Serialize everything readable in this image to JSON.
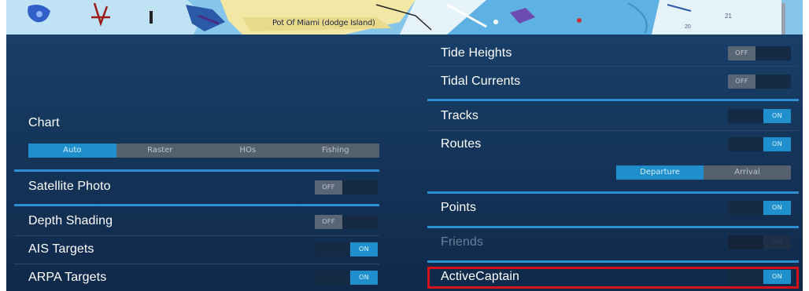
{
  "map": {
    "label": "Pot Of Miami (dodge Island)",
    "depth_a": "21",
    "depth_b": "20"
  },
  "chart_section": {
    "title": "Chart",
    "modes": [
      "Auto",
      "Raster",
      "HOs",
      "Fishing"
    ],
    "selected_mode": "Auto"
  },
  "left_rows": [
    {
      "label": "Satellite Photo",
      "state": "OFF"
    },
    {
      "label": "Depth Shading",
      "state": "OFF"
    },
    {
      "label": "AIS Targets",
      "state": "ON"
    },
    {
      "label": "ARPA Targets",
      "state": "ON"
    }
  ],
  "right_rows": [
    {
      "label": "Tide Heights",
      "state": "OFF"
    },
    {
      "label": "Tidal Currents",
      "state": "OFF"
    },
    {
      "label": "Tracks",
      "state": "ON"
    },
    {
      "label": "Routes",
      "state": "ON"
    },
    {
      "label": "Points",
      "state": "ON"
    },
    {
      "label": "Friends",
      "state": "ON",
      "disabled": true
    },
    {
      "label": "ActiveCaptain",
      "state": "ON",
      "highlighted": true
    }
  ],
  "routes_segment": {
    "options": [
      "Departure",
      "Arrival"
    ],
    "selected": "Departure"
  },
  "colors": {
    "panel_bg": "#143559",
    "accent": "#1f90cd",
    "separator": "#2d8fd2",
    "highlight": "#d7111a"
  }
}
